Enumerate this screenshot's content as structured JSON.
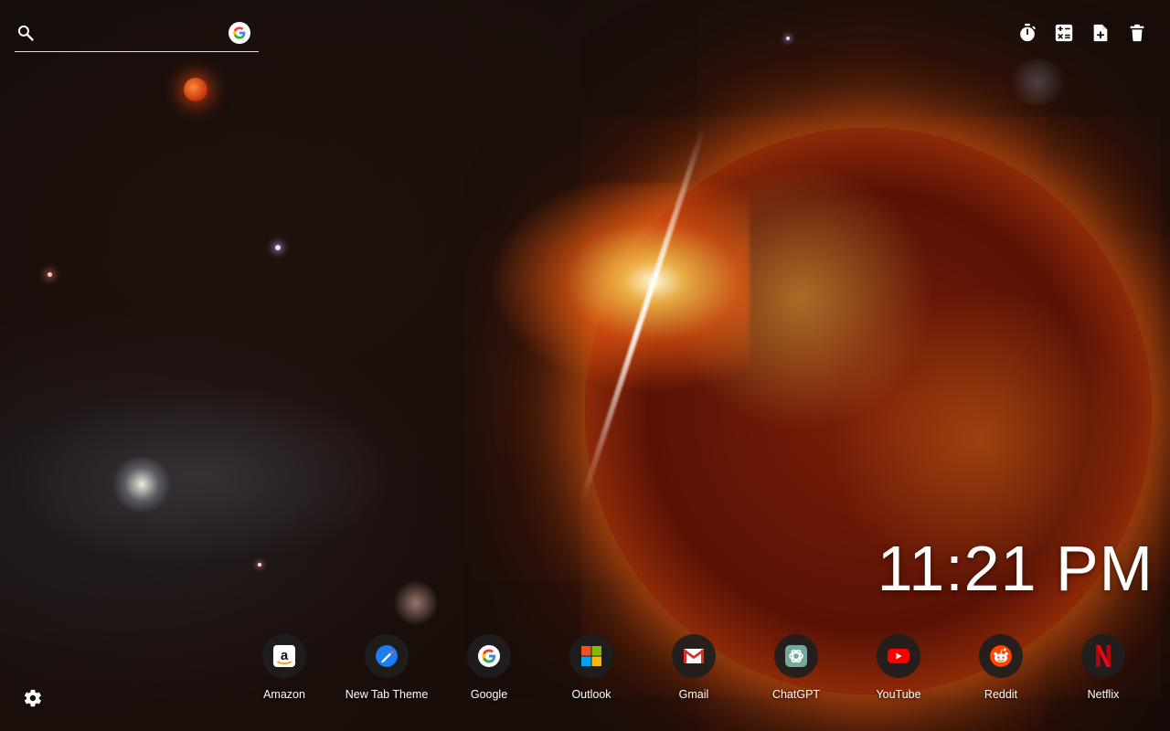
{
  "search": {
    "placeholder": "",
    "value": "",
    "engine_icon": "google-g-icon"
  },
  "tools": [
    {
      "name": "timer-icon",
      "label": "Timer"
    },
    {
      "name": "calculator-icon",
      "label": "Calculator"
    },
    {
      "name": "add-note-icon",
      "label": "Notes"
    },
    {
      "name": "trash-icon",
      "label": "Clear"
    }
  ],
  "clock": {
    "time": "11:21 PM"
  },
  "shortcuts": [
    {
      "label": "Amazon",
      "icon": "amazon-icon"
    },
    {
      "label": "New Tab Theme",
      "icon": "new-tab-theme-icon"
    },
    {
      "label": "Google",
      "icon": "google-icon"
    },
    {
      "label": "Outlook",
      "icon": "outlook-icon"
    },
    {
      "label": "Gmail",
      "icon": "gmail-icon"
    },
    {
      "label": "ChatGPT",
      "icon": "chatgpt-icon"
    },
    {
      "label": "YouTube",
      "icon": "youtube-icon"
    },
    {
      "label": "Reddit",
      "icon": "reddit-icon"
    },
    {
      "label": "Netflix",
      "icon": "netflix-icon"
    }
  ],
  "settings": {
    "icon": "gear-icon"
  },
  "colors": {
    "accent_sun": "#ff8a1e",
    "tile_bg": "#1e1e1e",
    "text": "#ffffff"
  }
}
